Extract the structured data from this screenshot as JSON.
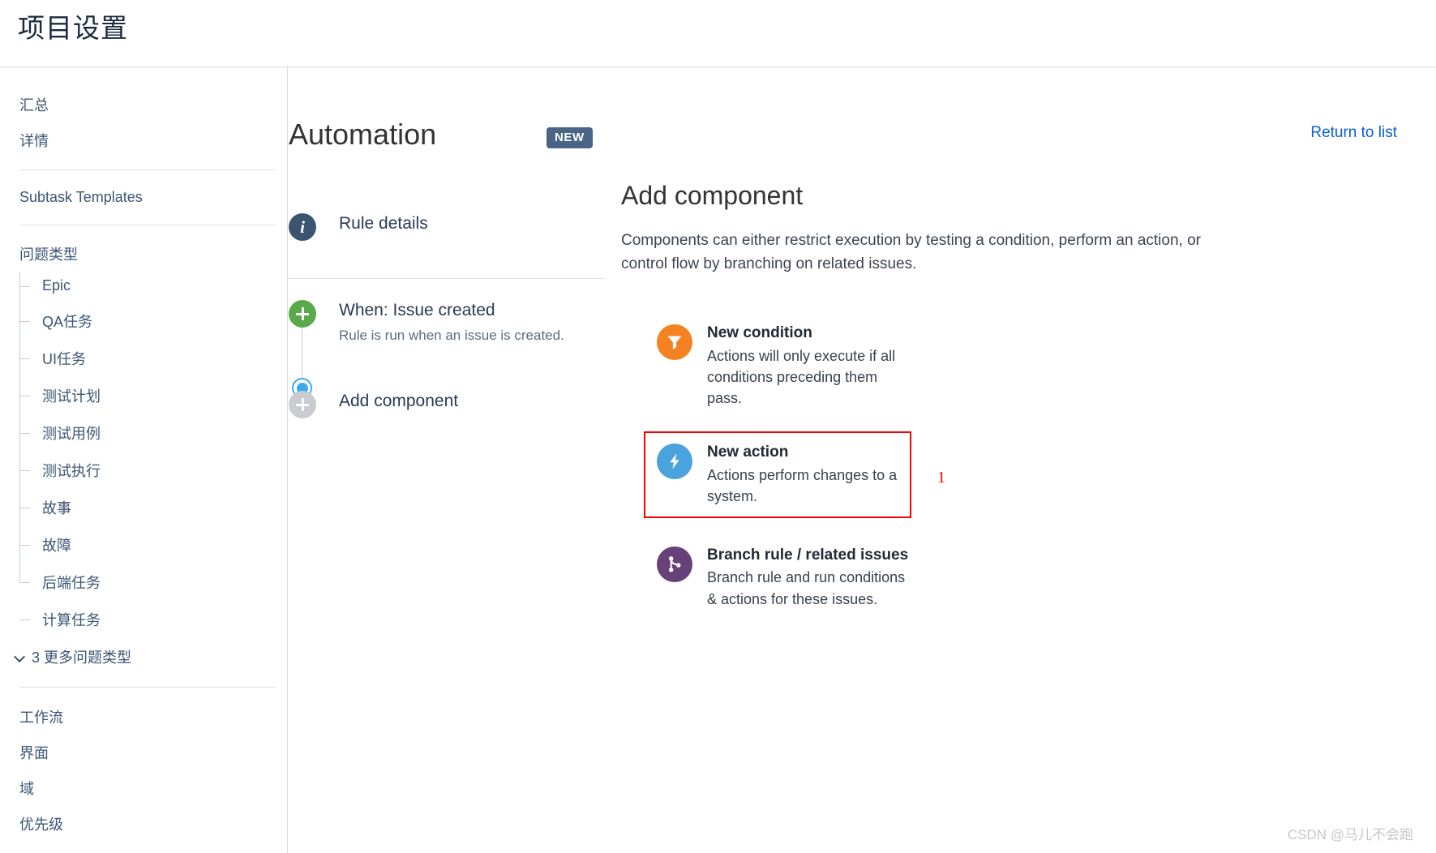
{
  "header": {
    "title": "项目设置"
  },
  "sidebar": {
    "top_links": [
      {
        "label": "汇总"
      },
      {
        "label": "详情"
      }
    ],
    "templates_link": {
      "label": "Subtask Templates"
    },
    "issue_types_heading": "问题类型",
    "issue_types": [
      {
        "label": "Epic"
      },
      {
        "label": "QA任务"
      },
      {
        "label": "UI任务"
      },
      {
        "label": "测试计划"
      },
      {
        "label": "测试用例"
      },
      {
        "label": "测试执行"
      },
      {
        "label": "故事"
      },
      {
        "label": "故障"
      },
      {
        "label": "后端任务"
      },
      {
        "label": "计算任务"
      }
    ],
    "more_types": {
      "label": "3 更多问题类型"
    },
    "bottom_links": [
      {
        "label": "工作流"
      },
      {
        "label": "界面"
      },
      {
        "label": "域"
      },
      {
        "label": "优先级"
      }
    ]
  },
  "page": {
    "title": "Automation",
    "badge": "NEW",
    "return_link": "Return to list"
  },
  "rule": {
    "details_label": "Rule details",
    "trigger_title": "When: Issue created",
    "trigger_sub": "Rule is run when an issue is created.",
    "add_component_label": "Add component"
  },
  "add_component": {
    "title": "Add component",
    "description": "Components can either restrict execution by testing a condition, perform an action, or control flow by branching on related issues.",
    "options": [
      {
        "name": "New condition",
        "desc": "Actions will only execute if all conditions preceding them pass.",
        "icon": "funnel-icon",
        "color": "#f58220",
        "highlighted": false
      },
      {
        "name": "New action",
        "desc": "Actions perform changes to a system.",
        "icon": "lightning-bolt-icon",
        "color": "#4aa3dd",
        "highlighted": true
      },
      {
        "name": "Branch rule / related issues",
        "desc": "Branch rule and run conditions & actions for these issues.",
        "icon": "branch-icon",
        "color": "#664279",
        "highlighted": false
      }
    ],
    "annotation_marker": "1"
  },
  "colors": {
    "badge": "#4a6485",
    "link": "#0b5fd7",
    "highlight": "#fb0000",
    "trigger_green": "#5aaa4b",
    "selection_blue": "#3eaaea"
  },
  "watermark": {
    "text": "CSDN @马儿不会跑"
  }
}
